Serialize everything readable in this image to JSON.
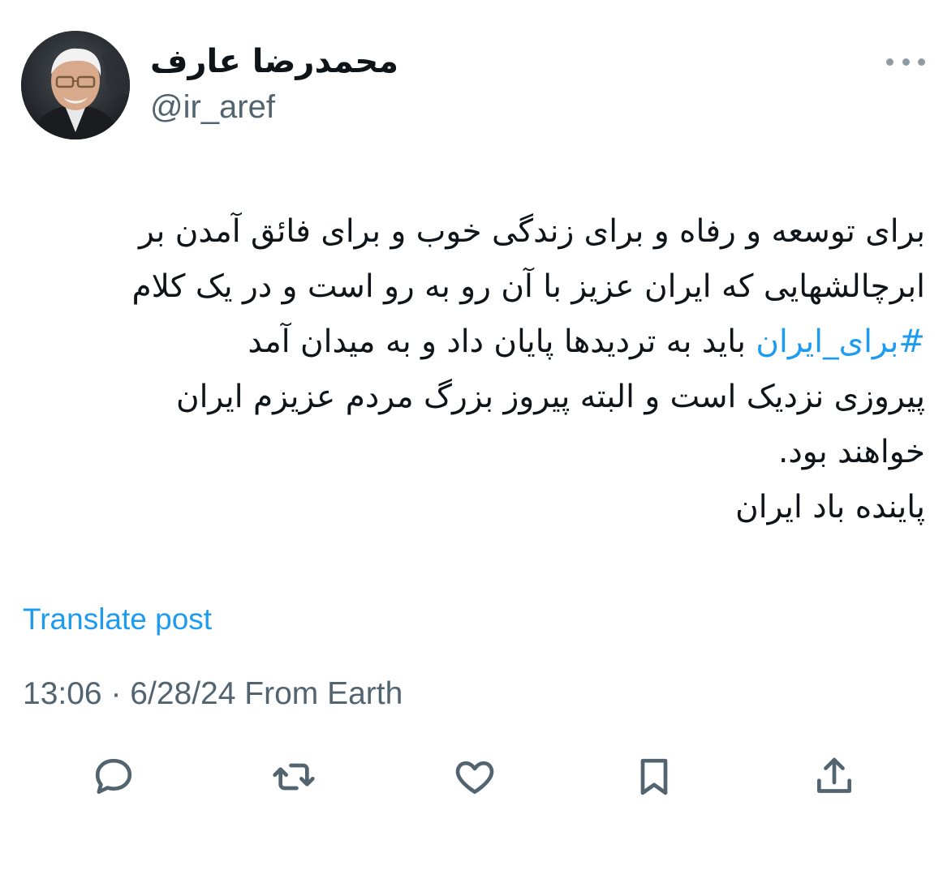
{
  "author": {
    "display_name": "محمدرضا عارف",
    "handle": "@ir_aref"
  },
  "post": {
    "lines": [
      "برای توسعه و رفاه و برای زندگی خوب و برای فائق آمدن بر",
      "ابرچالشهایی که ایران عزیز با آن رو به رو است و در یک کلام"
    ],
    "hashtag": "#برای_ایران",
    "hashtag_line_rest": "باید به تردیدها پایان داد و به میدان آمد",
    "lines_after": [
      "پیروزی نزدیک است و البته پیروز بزرگ مردم عزیزم ایران",
      "خواهند بود.",
      "پاینده باد ایران"
    ]
  },
  "translate_label": "Translate post",
  "meta": {
    "time": "13:06",
    "separator": "·",
    "date": "6/28/24",
    "source": "From Earth"
  },
  "icons": {
    "more": "more-horizontal-icon",
    "reply": "reply-icon",
    "repost": "repost-icon",
    "like": "heart-icon",
    "bookmark": "bookmark-icon",
    "share": "share-icon"
  },
  "colors": {
    "accent": "#1d9bf0",
    "secondary_text": "#536471",
    "primary_text": "#0f1419"
  }
}
